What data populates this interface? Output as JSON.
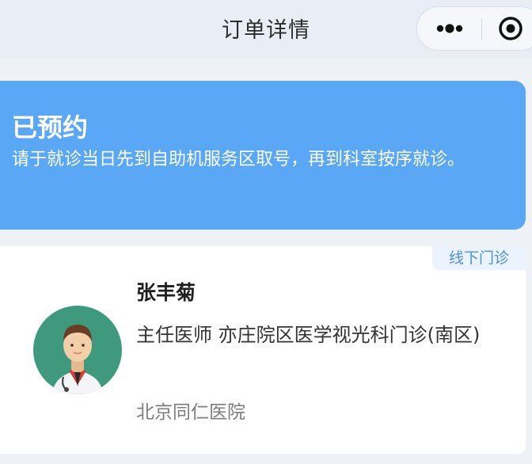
{
  "nav": {
    "title": "订单详情",
    "more_icon": "more-dots-icon",
    "close_icon": "target-circle-icon"
  },
  "status": {
    "title": "已预约",
    "description": "请于就诊当日先到自助机服务区取号，再到科室按序就诊。",
    "background_color": "#5aa8f5"
  },
  "doctor": {
    "tag": "线下门诊",
    "name": "张丰菊",
    "title_and_department": "主任医师 亦庄院区医学视光科门诊(南区)",
    "hospital": "北京同仁医院",
    "avatar_icon": "doctor-avatar-icon"
  }
}
